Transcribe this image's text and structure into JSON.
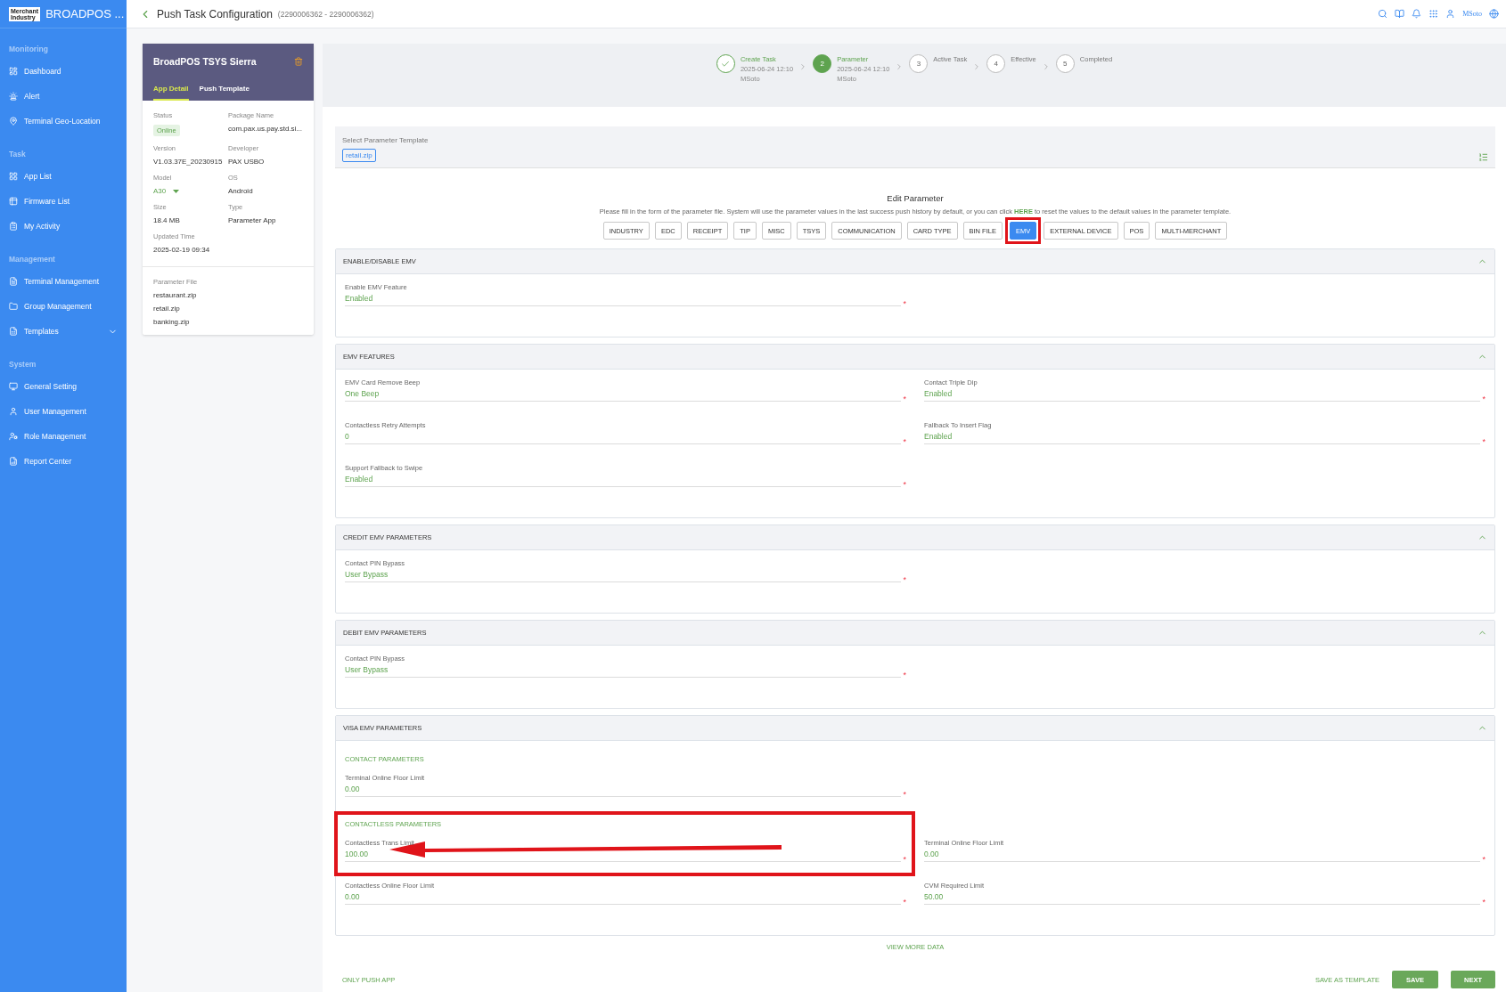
{
  "brand": {
    "logo_top": "Merchant",
    "logo_bottom": "Industry",
    "name": "BROADPOS ..."
  },
  "sidebar": [
    {
      "heading": "Monitoring",
      "items": [
        {
          "label": "Dashboard",
          "kind": "link"
        },
        {
          "label": "Alert",
          "kind": "link"
        },
        {
          "label": "Terminal Geo-Location",
          "kind": "link"
        }
      ]
    },
    {
      "heading": "Task",
      "items": [
        {
          "label": "App List",
          "kind": "link"
        },
        {
          "label": "Firmware List",
          "kind": "link"
        },
        {
          "label": "My Activity",
          "kind": "link"
        }
      ]
    },
    {
      "heading": "Management",
      "items": [
        {
          "label": "Terminal Management",
          "kind": "link"
        },
        {
          "label": "Group Management",
          "kind": "link"
        },
        {
          "label": "Templates",
          "kind": "submenu"
        }
      ]
    },
    {
      "heading": "System",
      "items": [
        {
          "label": "General Setting",
          "kind": "link"
        },
        {
          "label": "User Management",
          "kind": "link"
        },
        {
          "label": "Role Management",
          "kind": "link"
        },
        {
          "label": "Report Center",
          "kind": "link"
        }
      ]
    }
  ],
  "header": {
    "title": "Push Task Configuration",
    "subtitle": "(2290006362 - 2290006362)",
    "user": "MSoto"
  },
  "app_card": {
    "title": "BroadPOS TSYS Sierra",
    "tabs": [
      {
        "label": "App Detail",
        "selected": true
      },
      {
        "label": "Push Template",
        "selected": false
      }
    ],
    "details": [
      {
        "label": "Status",
        "value": "Online",
        "kind": "badge"
      },
      {
        "label": "Package Name",
        "value": "com.pax.us.pay.std.si...",
        "kind": "text"
      },
      {
        "label": "Version",
        "value": "V1.03.37E_20230915",
        "kind": "text"
      },
      {
        "label": "Developer",
        "value": "PAX USBO",
        "kind": "text"
      },
      {
        "label": "Model",
        "value": "A30",
        "kind": "dropdown"
      },
      {
        "label": "OS",
        "value": "Android",
        "kind": "text"
      },
      {
        "label": "Size",
        "value": "18.4 MB",
        "kind": "text"
      },
      {
        "label": "Type",
        "value": "Parameter App",
        "kind": "text"
      },
      {
        "label": "Updated Time",
        "value": "2025-02-19 09:34",
        "kind": "text"
      }
    ],
    "parameter_file": {
      "label": "Parameter File",
      "files": [
        "restaurant.zip",
        "retail.zip",
        "banking.zip"
      ]
    }
  },
  "stepper": [
    {
      "title": "Create Task",
      "date": "2025-06-24 12:10",
      "user": "MSoto",
      "completed": true,
      "selected": false
    },
    {
      "number": "2",
      "title": "Parameter",
      "date": "2025-06-24 12:10",
      "user": "MSoto",
      "completed": false,
      "selected": true
    },
    {
      "number": "3",
      "title": "Active Task",
      "completed": false,
      "selected": false
    },
    {
      "number": "4",
      "title": "Effective",
      "completed": false,
      "selected": false
    },
    {
      "number": "5",
      "title": "Completed",
      "completed": false,
      "selected": false
    }
  ],
  "required_mark": "*",
  "template": {
    "label": "Select Parameter Template",
    "chip": "retail.zip"
  },
  "edit_parameter": {
    "title": "Edit Parameter",
    "hint_before": "Please fill in the form of the parameter file. System will use the parameter values in the last success push history by default, or you can click",
    "hint_link": "HERE",
    "hint_after": "to reset the values to the default values in the parameter template.",
    "tabs": [
      {
        "label": "INDUSTRY",
        "selected": false,
        "highlighted": false
      },
      {
        "label": "EDC",
        "selected": false,
        "highlighted": false
      },
      {
        "label": "RECEIPT",
        "selected": false,
        "highlighted": false
      },
      {
        "label": "TIP",
        "selected": false,
        "highlighted": false
      },
      {
        "label": "MISC",
        "selected": false,
        "highlighted": false
      },
      {
        "label": "TSYS",
        "selected": false,
        "highlighted": false
      },
      {
        "label": "COMMUNICATION",
        "selected": false,
        "highlighted": false
      },
      {
        "label": "CARD TYPE",
        "selected": false,
        "highlighted": false
      },
      {
        "label": "BIN FILE",
        "selected": false,
        "highlighted": false
      },
      {
        "label": "EMV",
        "selected": true,
        "highlighted": true
      },
      {
        "label": "EXTERNAL DEVICE",
        "selected": false,
        "highlighted": false
      },
      {
        "label": "POS",
        "selected": false,
        "highlighted": false
      },
      {
        "label": "MULTI-MERCHANT",
        "selected": false,
        "highlighted": false
      }
    ]
  },
  "sections": [
    {
      "title": "ENABLE/DISABLE EMV",
      "expanded": true,
      "groups": [
        {
          "highlighted": false,
          "rows": [
            [
              {
                "label": "Enable EMV Feature",
                "value": "Enabled",
                "required": true
              },
              null
            ]
          ]
        }
      ]
    },
    {
      "title": "EMV FEATURES",
      "expanded": true,
      "groups": [
        {
          "highlighted": false,
          "rows": [
            [
              {
                "label": "EMV Card Remove Beep",
                "value": "One Beep",
                "required": true
              },
              {
                "label": "Contact Triple Dip",
                "value": "Enabled",
                "required": true
              }
            ],
            [
              {
                "label": "Contactless Retry Attempts",
                "value": "0",
                "required": true
              },
              {
                "label": "Fallback To Insert Flag",
                "value": "Enabled",
                "required": true
              }
            ],
            [
              {
                "label": "Support Fallback to Swipe",
                "value": "Enabled",
                "required": true
              },
              null
            ]
          ]
        }
      ]
    },
    {
      "title": "CREDIT EMV PARAMETERS",
      "expanded": true,
      "groups": [
        {
          "highlighted": false,
          "rows": [
            [
              {
                "label": "Contact PIN Bypass",
                "value": "User Bypass",
                "required": true
              },
              null
            ]
          ]
        }
      ]
    },
    {
      "title": "DEBIT EMV PARAMETERS",
      "expanded": true,
      "groups": [
        {
          "highlighted": false,
          "rows": [
            [
              {
                "label": "Contact PIN Bypass",
                "value": "User Bypass",
                "required": true
              },
              null
            ]
          ]
        }
      ]
    },
    {
      "title": "VISA EMV PARAMETERS",
      "expanded": true,
      "groups": [
        {
          "subtitle": "CONTACT PARAMETERS",
          "highlighted": false,
          "rows": [
            [
              {
                "label": "Terminal Online Floor Limit",
                "value": "0.00",
                "required": true
              },
              null
            ]
          ]
        },
        {
          "subtitle": "CONTACTLESS PARAMETERS",
          "highlighted": true,
          "rows": [
            [
              {
                "label": "Contactless Trans Limit",
                "value": "100.00",
                "required": true
              },
              {
                "label": "Terminal Online Floor Limit",
                "value": "0.00",
                "required": true
              }
            ],
            [
              {
                "label": "Contactless Online Floor Limit",
                "value": "0.00",
                "required": true
              },
              {
                "label": "CVM Required Limit",
                "value": "50.00",
                "required": true
              }
            ]
          ]
        }
      ]
    }
  ],
  "view_more": "VIEW MORE DATA",
  "footer": {
    "left": "ONLY PUSH APP",
    "save_template": "SAVE AS TEMPLATE",
    "save": "SAVE",
    "next": "NEXT"
  }
}
